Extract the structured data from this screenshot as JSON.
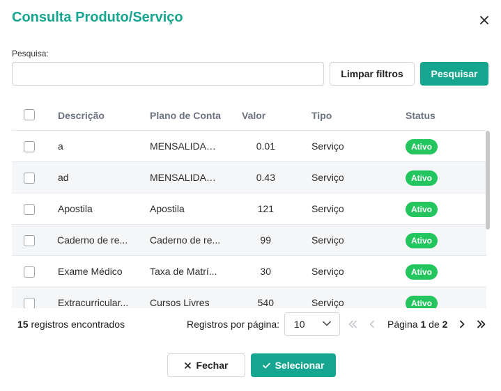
{
  "dialog": {
    "title": "Consulta Produto/Serviço"
  },
  "search": {
    "label": "Pesquisa:",
    "value": "",
    "placeholder": "",
    "clear_label": "Limpar filtros",
    "search_label": "Pesquisar"
  },
  "table": {
    "headers": {
      "descricao": "Descrição",
      "plano": "Plano de Conta",
      "valor": "Valor",
      "tipo": "Tipo",
      "status": "Status"
    },
    "rows": [
      {
        "descricao": "a",
        "plano": "MENSALIDADE...",
        "valor": "0.01",
        "tipo": "Serviço",
        "status": "Ativo"
      },
      {
        "descricao": "ad",
        "plano": "MENSALIDADE...",
        "valor": "0.43",
        "tipo": "Serviço",
        "status": "Ativo"
      },
      {
        "descricao": "Apostila",
        "plano": "Apostila",
        "valor": "121",
        "tipo": "Serviço",
        "status": "Ativo"
      },
      {
        "descricao": "Caderno de re...",
        "plano": "Caderno de re...",
        "valor": "99",
        "tipo": "Serviço",
        "status": "Ativo"
      },
      {
        "descricao": "Exame Médico",
        "plano": "Taxa de Matrí...",
        "valor": "30",
        "tipo": "Serviço",
        "status": "Ativo"
      },
      {
        "descricao": "Extracurricular...",
        "plano": "Cursos Livres",
        "valor": "540",
        "tipo": "Serviço",
        "status": "Ativo"
      }
    ]
  },
  "footer": {
    "count_number": "15",
    "count_suffix": " registros encontrados",
    "per_page_label": "Registros por página:",
    "per_page_value": "10",
    "page_prefix": "Página ",
    "page_current": "1",
    "page_of": " de ",
    "page_total": "2"
  },
  "actions": {
    "close_label": "Fechar",
    "select_label": "Selecionar"
  },
  "colors": {
    "accent": "#16a58e",
    "badge": "#22c55e"
  }
}
